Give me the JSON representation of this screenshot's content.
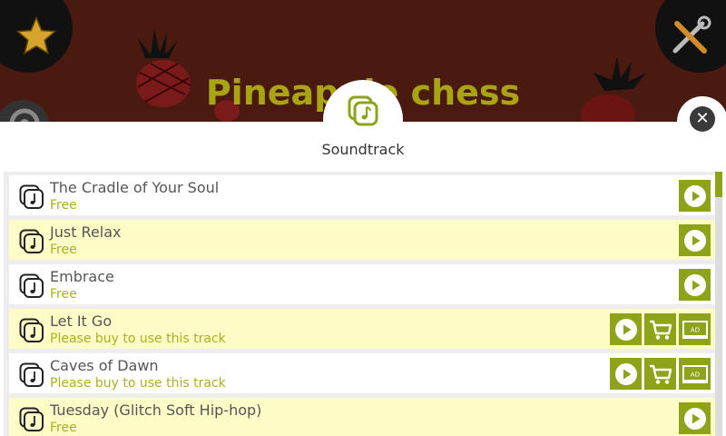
{
  "background": {
    "title": "Pineapple chess",
    "accent": "#a8a413"
  },
  "panel": {
    "icon": "music-folder-icon",
    "title": "Soundtrack",
    "close_icon": "close-icon",
    "accent": "#8fa31a",
    "row_highlight": "#fdfbc6"
  },
  "corner_buttons": [
    "star-icon",
    "tools-icon",
    "wheel-icon"
  ],
  "tracks": [
    {
      "name": "The Cradle of Your Soul",
      "status": "Free",
      "actions": [
        "play"
      ]
    },
    {
      "name": "Just Relax",
      "status": "Free",
      "actions": [
        "play"
      ]
    },
    {
      "name": "Embrace",
      "status": "Free",
      "actions": [
        "play"
      ]
    },
    {
      "name": "Let It Go",
      "status": "Please buy to use this track",
      "actions": [
        "play",
        "buy",
        "ad"
      ]
    },
    {
      "name": "Caves of Dawn",
      "status": "Please buy to use this track",
      "actions": [
        "play",
        "buy",
        "ad"
      ]
    },
    {
      "name": "Tuesday (Glitch Soft Hip-hop)",
      "status": "Free",
      "actions": [
        "play"
      ]
    }
  ],
  "ad_label": "AD"
}
